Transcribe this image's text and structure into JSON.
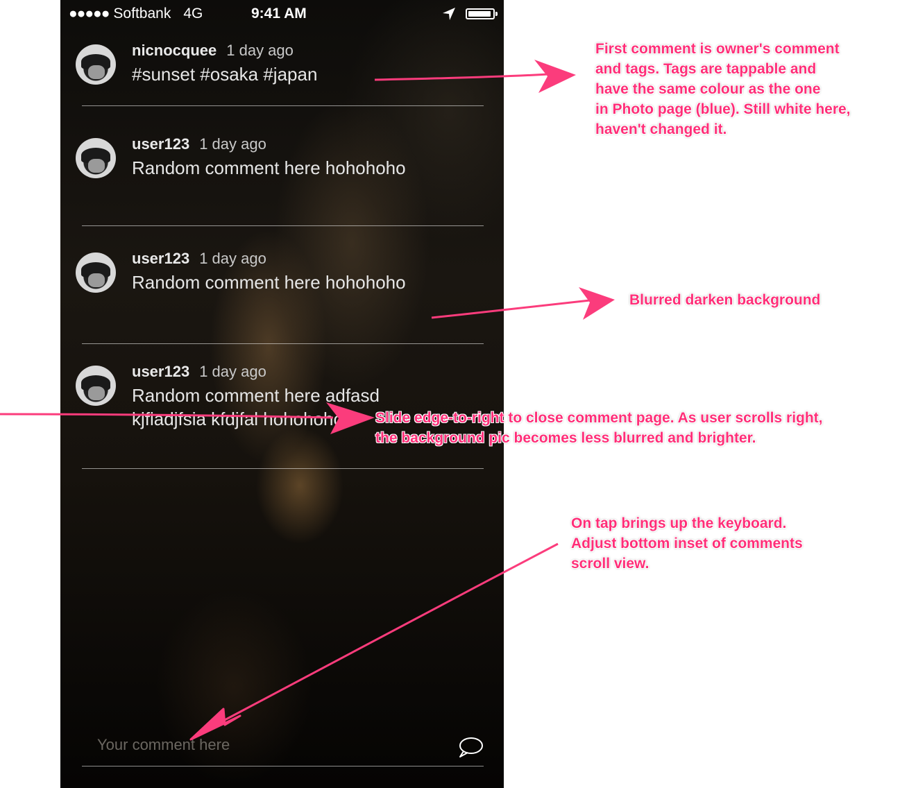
{
  "status_bar": {
    "signal": "●●●●●",
    "carrier": "Softbank",
    "network": "4G",
    "time": "9:41 AM",
    "battery_level": 0.95
  },
  "comments": [
    {
      "user": "nicnocquee",
      "time": "1 day ago",
      "text": "#sunset #osaka #japan"
    },
    {
      "user": "user123",
      "time": "1 day ago",
      "text": "Random comment here hohohoho"
    },
    {
      "user": "user123",
      "time": "1 day ago",
      "text": "Random comment here hohohoho"
    },
    {
      "user": "user123",
      "time": "1 day ago",
      "text": "Random comment here adfasd kjfiadjfsia kfdjfal hohohoho"
    }
  ],
  "composer": {
    "placeholder": "Your comment here",
    "value": ""
  },
  "annotations": {
    "owner_comment": [
      "First comment is owner's comment",
      "and tags. Tags are tappable and",
      "have the same colour as the one",
      "in Photo page (blue). Still white here,",
      "haven't changed it."
    ],
    "background": [
      "Blurred darken background"
    ],
    "swipe": [
      "Slide edge-to-right to close comment page. As user scrolls right,",
      "the background pic becomes less blurred and brighter."
    ],
    "keyboard": [
      "On tap brings up the keyboard.",
      "Adjust bottom inset of comments",
      "scroll view."
    ]
  },
  "colors": {
    "annotation": "#ff2e78",
    "arrow": "#fb3c7c"
  },
  "icons": [
    "location-arrow-icon",
    "battery-icon",
    "chat-bubble-icon"
  ]
}
